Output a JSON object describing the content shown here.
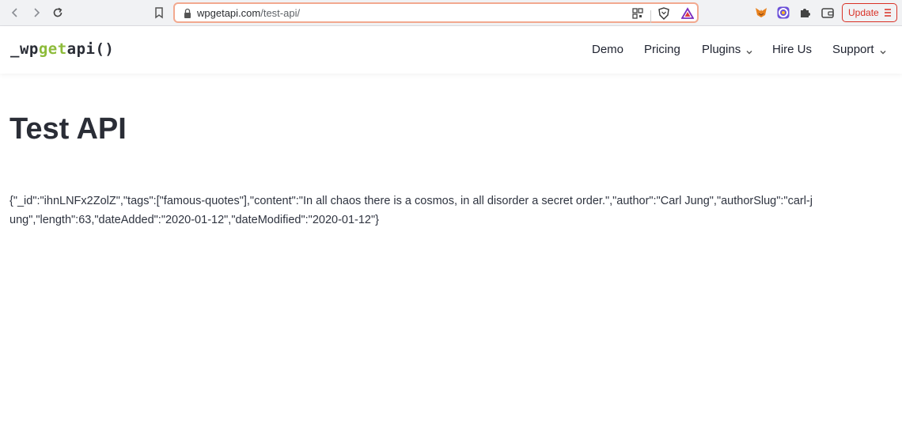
{
  "browser": {
    "url_domain": "wpgetapi.com",
    "url_path": "/test-api/",
    "update_label": "Update",
    "icons": [
      "back-icon",
      "forward-icon",
      "reload-icon",
      "bookmark-icon",
      "lock-icon",
      "qr-grid-icon",
      "brave-shield-icon",
      "brave-rewards-icon",
      "metamask-icon",
      "color-ext-icon",
      "puzzle-icon",
      "wallet-icon",
      "menu-icon"
    ],
    "accent": "#d93025"
  },
  "site": {
    "logo": {
      "prefix": "_wp",
      "middle": "get",
      "suffix": "api()"
    },
    "logo_accent": "#8dbb3a",
    "nav": [
      {
        "label": "Demo"
      },
      {
        "label": "Pricing"
      },
      {
        "label": "Plugins"
      },
      {
        "label": "Hire Us"
      },
      {
        "label": "Support"
      }
    ]
  },
  "page": {
    "title": "Test API",
    "output": "{\"_id\":\"ihnLNFx2ZolZ\",\"tags\":[\"famous-quotes\"],\"content\":\"In all chaos there is a cosmos, in all disorder a secret order.\",\"author\":\"Carl Jung\",\"authorSlug\":\"carl-jung\",\"length\":63,\"dateAdded\":\"2020-01-12\",\"dateModified\":\"2020-01-12\"}"
  }
}
